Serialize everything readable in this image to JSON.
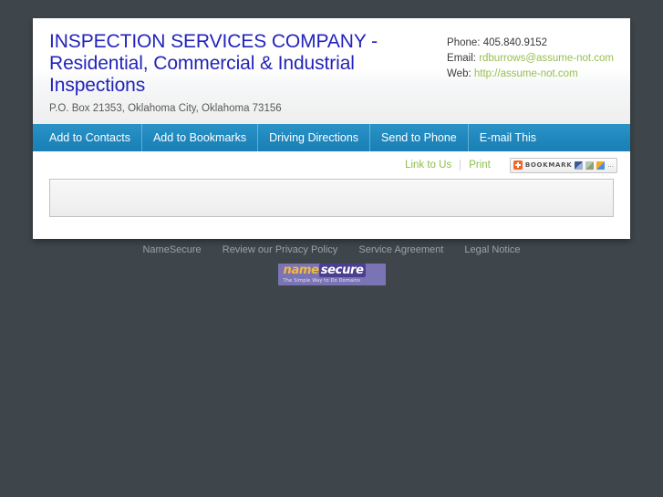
{
  "page": {
    "background_color": "#3e464b"
  },
  "header": {
    "title": "INSPECTION SERVICES COMPANY - Residential, Commercial & Industrial Inspections",
    "title_color": "#2323bb",
    "address": "P.O. Box 21353, Oklahoma City, Oklahoma 73156",
    "contact": {
      "phone_label": "Phone:",
      "phone_value": "405.840.9152",
      "email_label": "Email:",
      "email_value": "rdburrows@assume-not.com",
      "web_label": "Web:",
      "web_value": "http://assume-not.com",
      "link_color": "#96c04f"
    }
  },
  "nav": {
    "background_color": "#1f87bd",
    "items": [
      {
        "label": "Add to Contacts"
      },
      {
        "label": "Add to Bookmarks"
      },
      {
        "label": "Driving Directions"
      },
      {
        "label": "Send to Phone"
      },
      {
        "label": "E-mail This"
      }
    ]
  },
  "tools": {
    "link_to_us": "Link to Us",
    "print": "Print",
    "link_color": "#8cbf4a",
    "bookmark": {
      "label": "BOOKMARK",
      "plus_icon": "plus-icon",
      "accent_color": "#f26522",
      "more": "..."
    }
  },
  "content": {
    "box_text": ""
  },
  "footer": {
    "links": [
      {
        "label": "NameSecure"
      },
      {
        "label": "Review our Privacy Policy"
      },
      {
        "label": "Service Agreement"
      },
      {
        "label": "Legal Notice"
      }
    ],
    "logo": {
      "name_part": "name",
      "secure_part": "secure",
      "tagline": "The Simple Way to Do Domains",
      "background_color": "#7a74b4"
    }
  }
}
